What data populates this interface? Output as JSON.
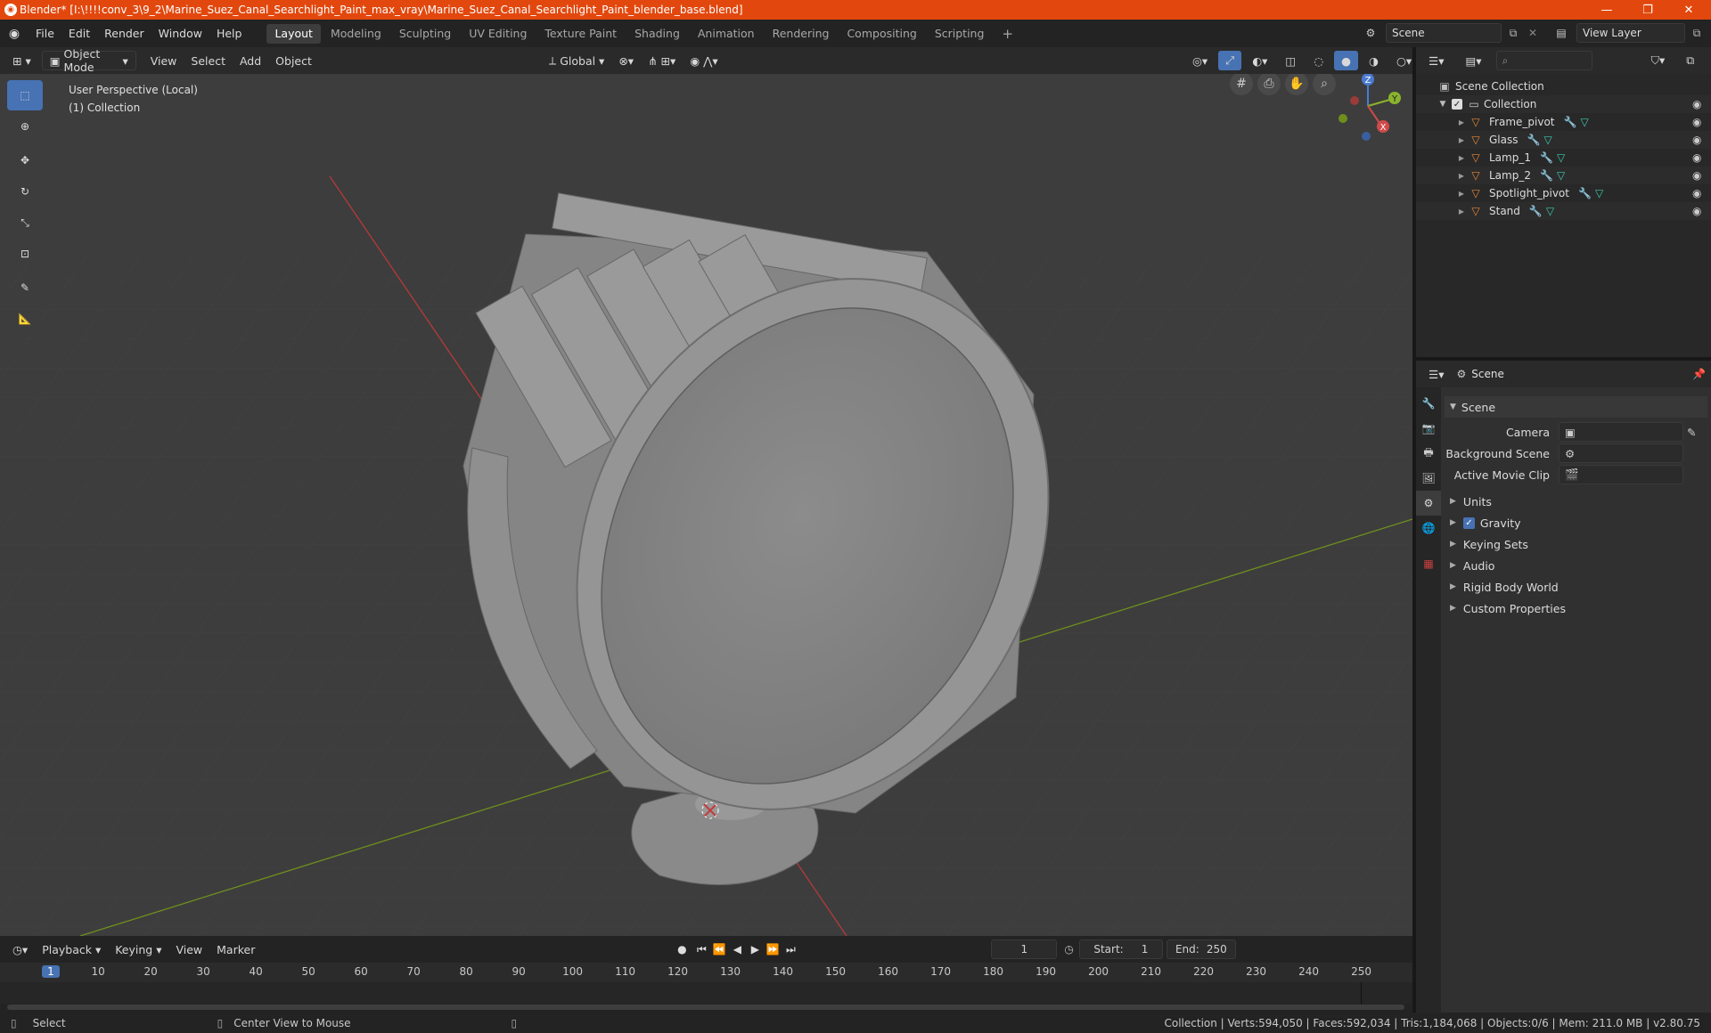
{
  "window": {
    "title": "Blender* [I:\\!!!!conv_3\\9_2\\Marine_Suez_Canal_Searchlight_Paint_max_vray\\Marine_Suez_Canal_Searchlight_Paint_blender_base.blend]"
  },
  "menu": [
    "File",
    "Edit",
    "Render",
    "Window",
    "Help"
  ],
  "workspaces": [
    "Layout",
    "Modeling",
    "Sculpting",
    "UV Editing",
    "Texture Paint",
    "Shading",
    "Animation",
    "Rendering",
    "Compositing",
    "Scripting"
  ],
  "scene_field": "Scene",
  "view_layer_field": "View Layer",
  "viewport_header": {
    "mode": "Object Mode",
    "menus": [
      "View",
      "Select",
      "Add",
      "Object"
    ],
    "orientation": "Global"
  },
  "viewport": {
    "perspective": "User Perspective (Local)",
    "collection": "(1) Collection"
  },
  "gizmo": {
    "x": "X",
    "y": "Y",
    "z": "Z"
  },
  "outliner": {
    "root": "Scene Collection",
    "collection": "Collection",
    "objects": [
      "Frame_pivot",
      "Glass",
      "Lamp_1",
      "Lamp_2",
      "Spotlight_pivot",
      "Stand"
    ]
  },
  "properties": {
    "context": "Scene",
    "panel": "Scene",
    "fields": [
      {
        "label": "Camera"
      },
      {
        "label": "Background Scene"
      },
      {
        "label": "Active Movie Clip"
      }
    ],
    "sections": [
      "Units",
      "Gravity",
      "Keying Sets",
      "Audio",
      "Rigid Body World",
      "Custom Properties"
    ]
  },
  "timeline": {
    "menus": [
      "Playback",
      "Keying",
      "View",
      "Marker"
    ],
    "current_frame": "1",
    "start_label": "Start:",
    "start": "1",
    "end_label": "End:",
    "end": "250",
    "ticks": [
      "1",
      "10",
      "20",
      "30",
      "40",
      "50",
      "60",
      "70",
      "80",
      "90",
      "100",
      "110",
      "120",
      "130",
      "140",
      "150",
      "160",
      "170",
      "180",
      "190",
      "200",
      "210",
      "220",
      "230",
      "240",
      "250"
    ]
  },
  "status": {
    "left": "Select",
    "middle": "Center View to Mouse",
    "right": "Collection | Verts:594,050 | Faces:592,034 | Tris:1,184,068 | Objects:0/6 | Mem: 211.0 MB | v2.80.75"
  },
  "colors": {
    "title_bar": "#e2480e",
    "accent": "#4772b3",
    "object_icon": "#e8883a",
    "modifier_icon": "#6ea6e8",
    "mesh_icon": "#3ec9b0"
  }
}
